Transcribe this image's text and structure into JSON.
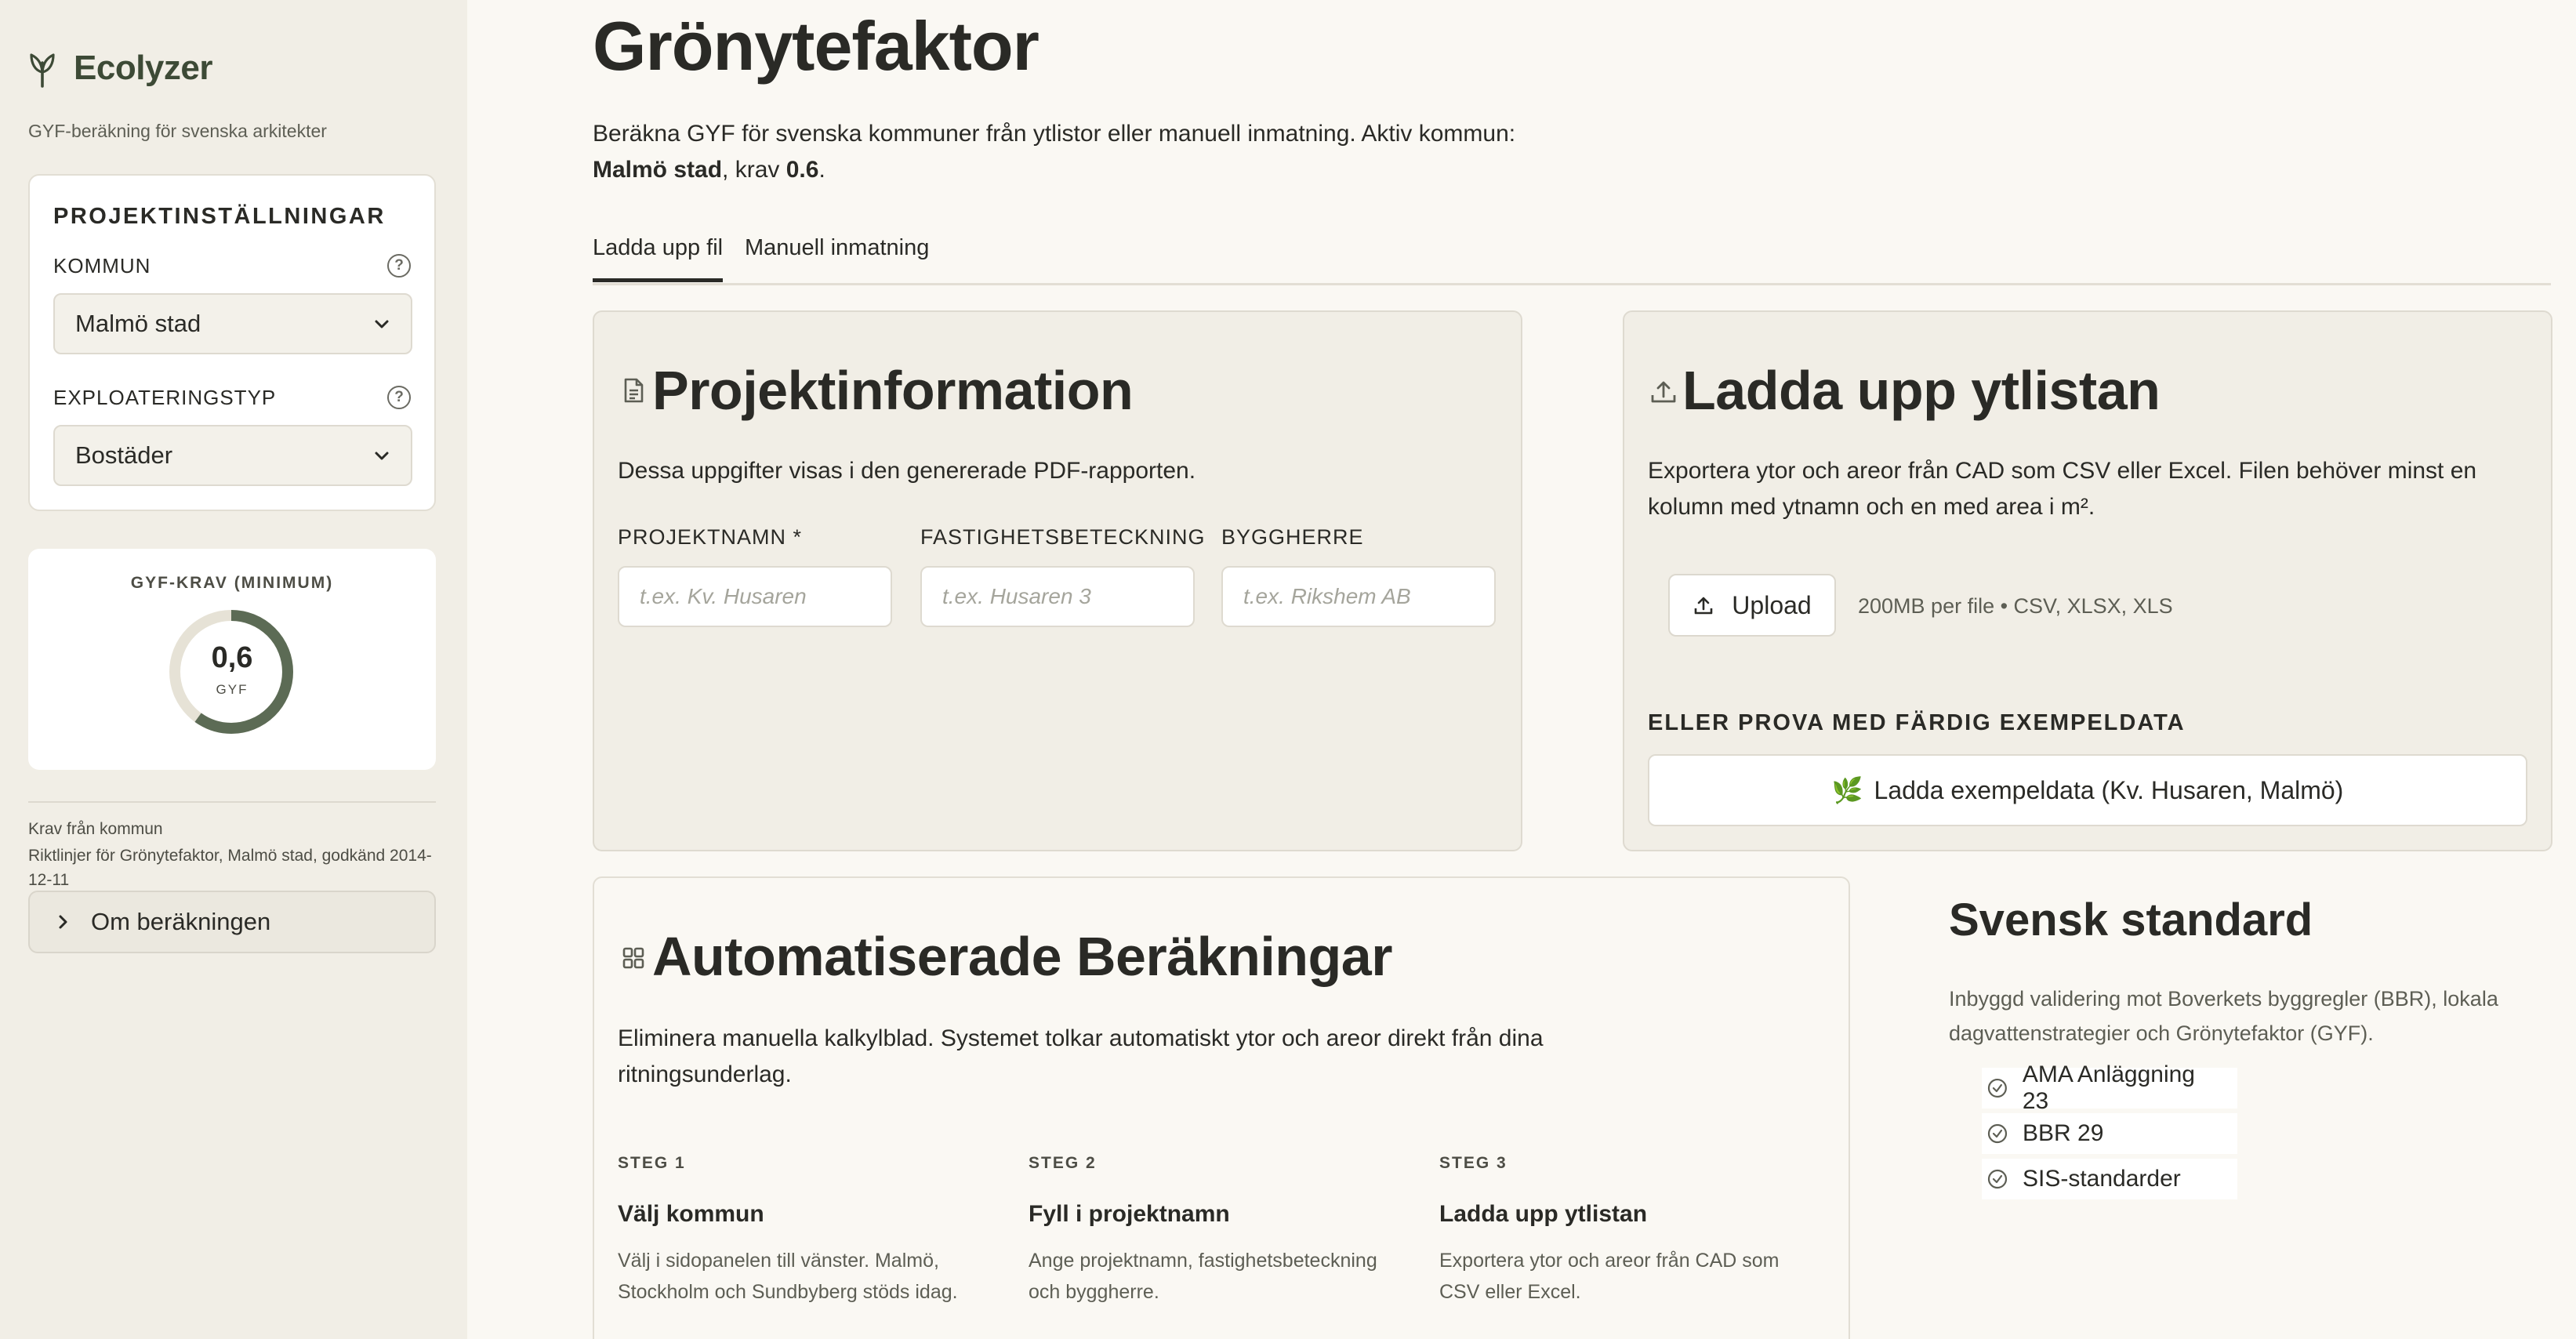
{
  "sidebar": {
    "brand_name": "Ecolyzer",
    "brand_sub": "GYF-beräkning för svenska arkitekter",
    "settings_title": "PROJEKTINSTÄLLNINGAR",
    "kommun_label": "KOMMUN",
    "kommun_value": "Malmö stad",
    "exploatering_label": "EXPLOATERINGSTYP",
    "exploatering_value": "Bostäder",
    "gyf_title": "GYF-KRAV (MINIMUM)",
    "gyf_value": "0,6",
    "gyf_unit": "GYF",
    "gyf_fraction": 0.6,
    "krav_label": "Krav från kommun",
    "krav_text": "Riktlinjer för Grönytefaktor, Malmö stad, godkänd 2014-12-11",
    "about_label": "Om beräkningen"
  },
  "main": {
    "title": "Grönytefaktor",
    "intro_text": "Beräkna GYF för svenska kommuner från ytlistor eller manuell inmatning. Aktiv kommun:",
    "intro_kommun": "Malmö stad",
    "intro_krav_prefix": ", krav ",
    "intro_krav_value": "0.6",
    "intro_end": ".",
    "tabs": [
      {
        "label": "Ladda upp fil",
        "active": true
      },
      {
        "label": "Manuell inmatning",
        "active": false
      }
    ]
  },
  "project_card": {
    "title": "Projektinformation",
    "desc": "Dessa uppgifter visas i den genererade PDF-rapporten.",
    "fields": [
      {
        "label": "PROJEKTNAMN *",
        "placeholder": "t.ex. Kv. Husaren",
        "value": ""
      },
      {
        "label": "FASTIGHETSBETECKNING",
        "placeholder": "t.ex. Husaren 3",
        "value": ""
      },
      {
        "label": "BYGGHERRE",
        "placeholder": "t.ex. Rikshem AB",
        "value": ""
      }
    ]
  },
  "upload_card": {
    "title": "Ladda upp ytlistan",
    "desc_1": "Exportera ytor och areor från CAD som CSV eller Excel. Filen behöver minst en",
    "desc_2": "kolumn med ytnamn och en med area i m².",
    "upload_label": "Upload",
    "upload_hint": "200MB per file • CSV, XLSX, XLS",
    "example_label": "ELLER PROVA MED FÄRDIG EXEMPELDATA",
    "example_emoji": "🌿",
    "example_button": "Ladda exempeldata (Kv. Husaren, Malmö)"
  },
  "auto_card": {
    "title": "Automatiserade Beräkningar",
    "desc_1": "Eliminera manuella kalkylblad. Systemet tolkar automatiskt ytor och areor direkt från dina",
    "desc_2": "ritningsunderlag.",
    "steps": [
      {
        "no": "STEG 1",
        "title": "Välj kommun",
        "desc": "Välj i sidopanelen till vänster. Malmö, Stockholm och Sundbyberg stöds idag."
      },
      {
        "no": "STEG 2",
        "title": "Fyll i projektnamn",
        "desc": "Ange projektnamn, fastighetsbeteckning och byggherre."
      },
      {
        "no": "STEG 3",
        "title": "Ladda upp ytlistan",
        "desc": "Exportera ytor och areor från CAD som CSV eller Excel."
      }
    ]
  },
  "standard": {
    "title": "Svensk standard",
    "desc": "Inbyggd validering mot Boverkets byggregler (BBR), lokala dagvattenstrategier och Grönytefaktor (GYF).",
    "items": [
      "AMA Anläggning 23",
      "BBR 29",
      "SIS-standarder"
    ]
  },
  "colors": {
    "accent": "#5c6b55",
    "ring_track": "#e6e2d6",
    "sidebar_bg": "#f1eee6",
    "page_bg": "#faf8f3"
  }
}
